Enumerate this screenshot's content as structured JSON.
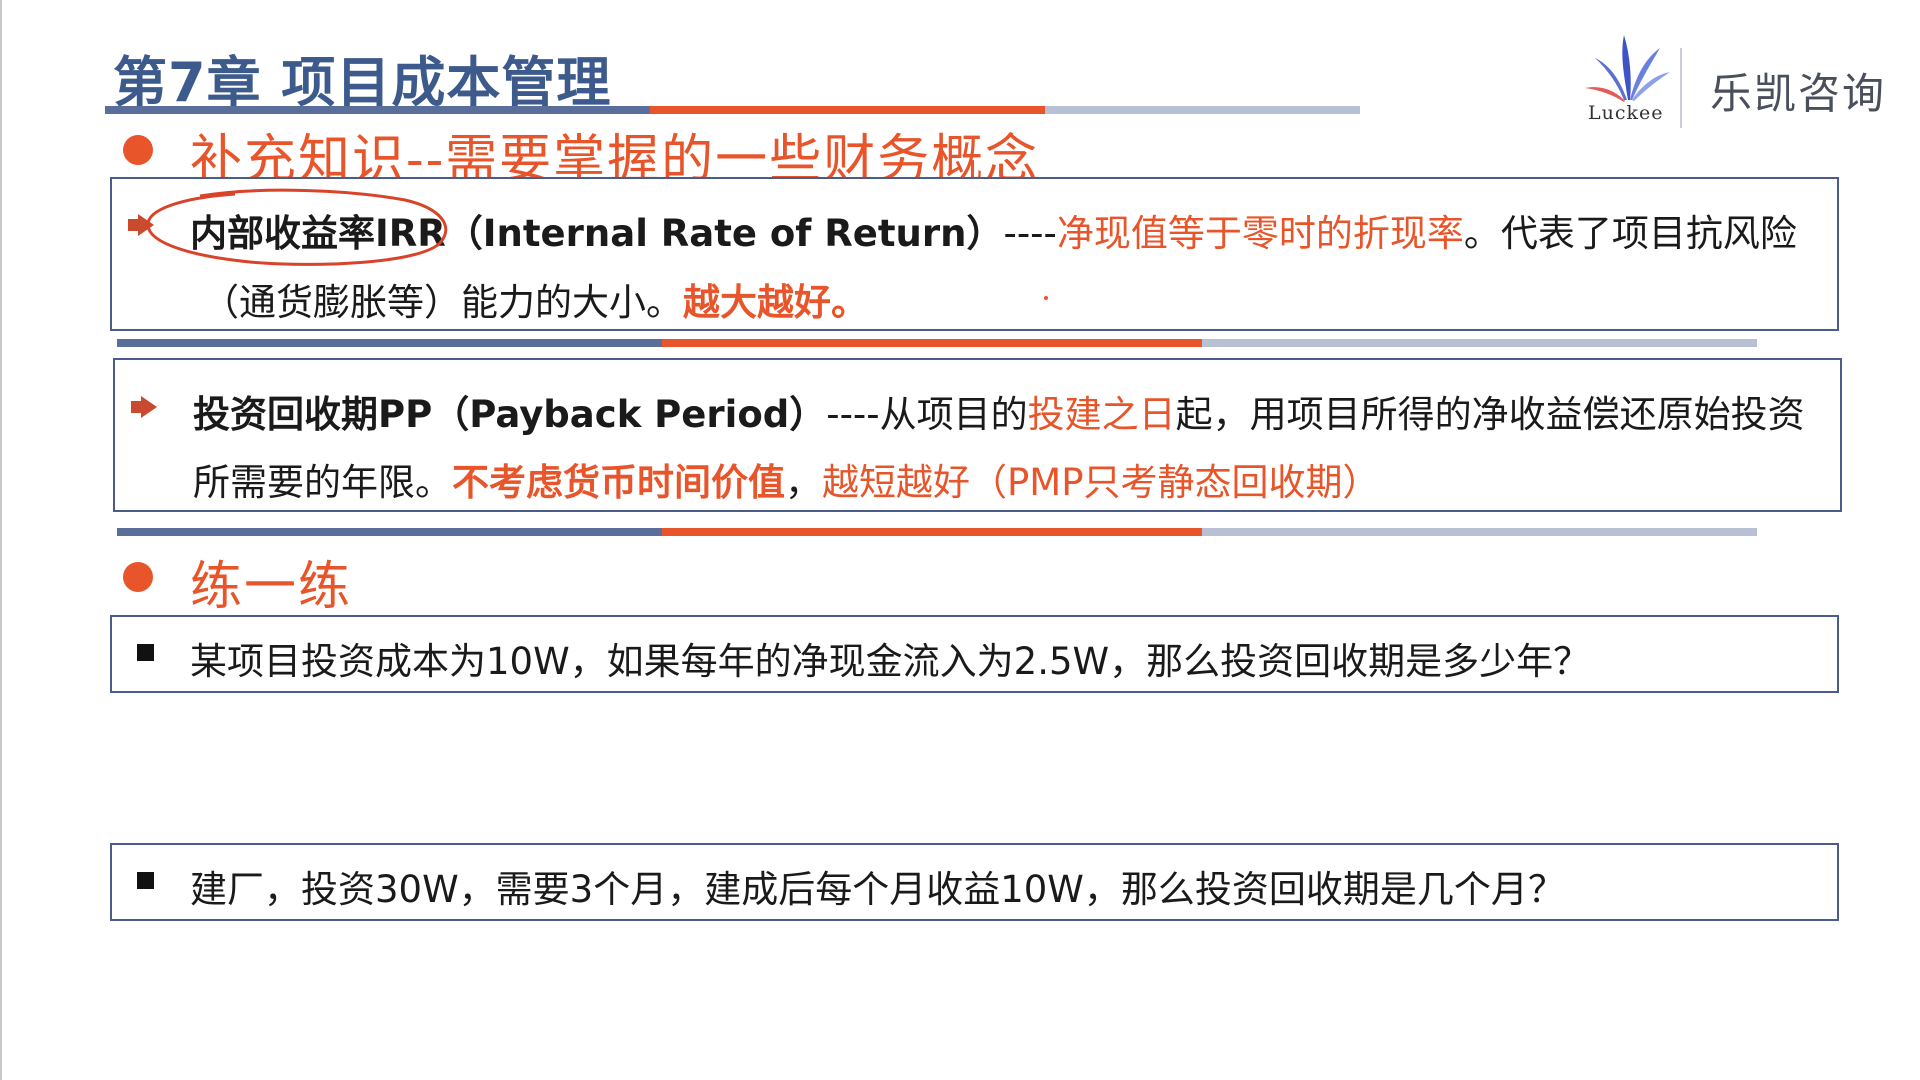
{
  "header": {
    "title": "第7章 项目成本管理",
    "logo_sub": "Luckee",
    "brand": "乐凯咨询"
  },
  "section1": {
    "title": "补充知识--需要掌握的一些财务概念",
    "irr": {
      "term": "内部收益率IRR（Internal Rate of Return）",
      "dashes": "----",
      "definition": "净现值等于零时的折现率",
      "rest_line1": "。代表了项目抗风险",
      "line2": "（通货膨胀等）能力的大小。",
      "emphasis": "越大越好。"
    },
    "pp": {
      "term": "投资回收期PP（Payback Period）",
      "dashes": "----",
      "text_a": "从项目的",
      "highlight": "投建之日",
      "text_b": "起，用项目所得的净收益偿还原始投资",
      "line2_a": "所需要的年限。",
      "line2_b": "不考虑货币时间价值",
      "line2_c": "，",
      "line2_d": "越短越好（PMP只考静态回收期）"
    }
  },
  "section2": {
    "title": "练一练",
    "q1": "某项目投资成本为10W，如果每年的净现金流入为2.5W，那么投资回收期是多少年？",
    "q2": "建厂，投资30W，需要3个月，建成后每个月收益10W，那么投资回收期是几个月？"
  },
  "colors": {
    "accent": "#e8552a",
    "title_blue": "#3d5a8c",
    "rule_blue": "#5a6e9c",
    "rule_orange": "#e8552a",
    "rule_light": "#b8c0d4"
  },
  "icons": {
    "logo": "fan-logo-icon",
    "bullet_dot": "orange-dot-icon",
    "bullet_arrow": "arrow-bullet-icon",
    "bullet_square": "black-square-icon",
    "annotation": "hand-drawn-circle-mark"
  }
}
